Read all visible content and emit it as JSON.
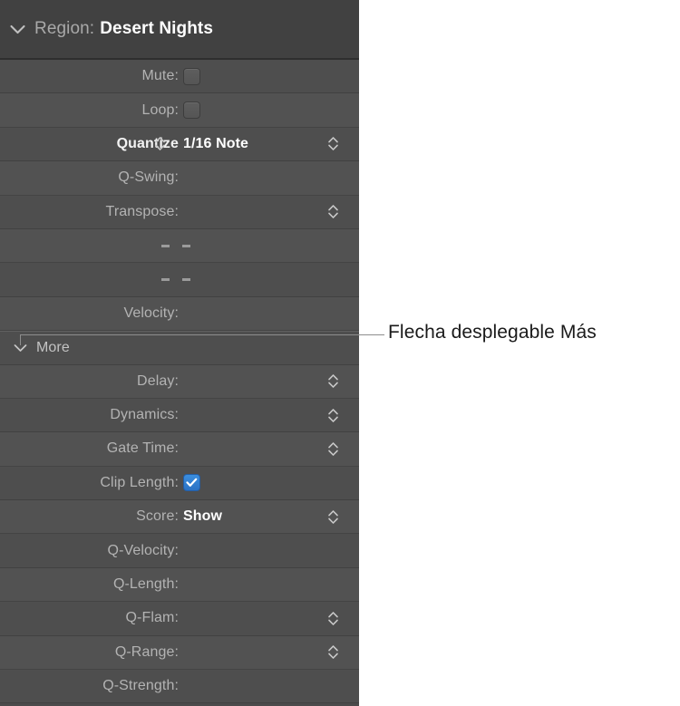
{
  "panel": {
    "header": {
      "disclosure_icon": "chevron-down-icon",
      "label": "Region:",
      "value": "Desert Nights"
    },
    "rows": [
      {
        "label": "Mute:",
        "control": "checkbox",
        "checked": false
      },
      {
        "label": "Loop:",
        "control": "checkbox",
        "checked": false
      },
      {
        "label": "Quantize",
        "control": "menu",
        "value": "1/16 Note",
        "bright": true,
        "inline_stepper": true,
        "stepper": true
      },
      {
        "label": "Q-Swing:",
        "control": "none"
      },
      {
        "label": "Transpose:",
        "control": "stepper",
        "stepper": true
      },
      {
        "label": "",
        "control": "dashes"
      },
      {
        "label": "",
        "control": "dashes"
      },
      {
        "label": "Velocity:",
        "control": "none"
      }
    ],
    "more": {
      "disclosure_icon": "chevron-down-icon",
      "label": "More"
    },
    "more_rows": [
      {
        "label": "Delay:",
        "control": "stepper",
        "stepper": true
      },
      {
        "label": "Dynamics:",
        "control": "stepper",
        "stepper": true
      },
      {
        "label": "Gate Time:",
        "control": "stepper",
        "stepper": true
      },
      {
        "label": "Clip Length:",
        "control": "checkbox",
        "checked": true
      },
      {
        "label": "Score:",
        "control": "menu",
        "value": "Show",
        "stepper": true
      },
      {
        "label": "Q-Velocity:",
        "control": "none"
      },
      {
        "label": "Q-Length:",
        "control": "none"
      },
      {
        "label": "Q-Flam:",
        "control": "stepper",
        "stepper": true
      },
      {
        "label": "Q-Range:",
        "control": "stepper",
        "stepper": true
      },
      {
        "label": "Q-Strength:",
        "control": "none"
      }
    ]
  },
  "callout": {
    "text": "Flecha desplegable Más"
  },
  "colors": {
    "panel_background": "#4b4b4b",
    "header_background": "#414141",
    "row_odd": "#4e4e4e",
    "row_even": "#525252",
    "label_text": "#b3b3b3",
    "value_text": "#ffffff",
    "checkbox_on": "#2b72c4",
    "callout_line": "#8e8e8e",
    "callout_text": "#1a1a1a",
    "page_background": "#ffffff"
  }
}
